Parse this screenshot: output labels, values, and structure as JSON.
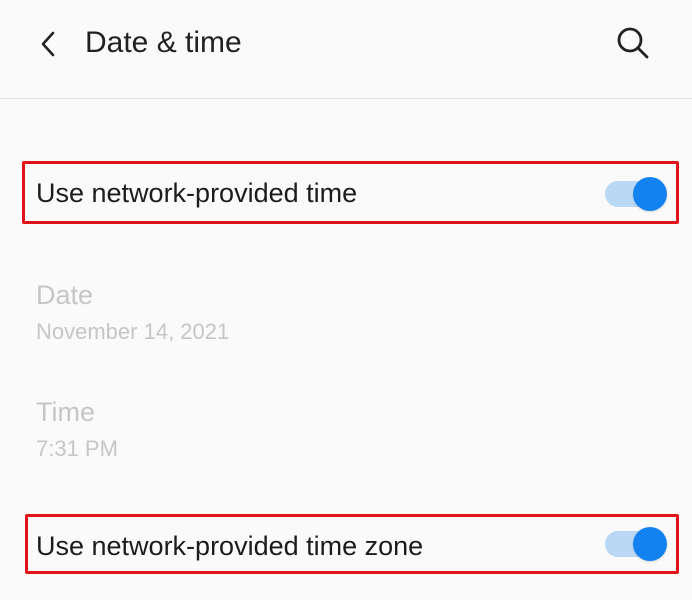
{
  "header": {
    "title": "Date & time",
    "back_icon": "chevron-left-icon",
    "search_icon": "search-icon"
  },
  "settings": {
    "network_time": {
      "label": "Use network-provided time",
      "enabled": true
    },
    "date": {
      "label": "Date",
      "value": "November 14, 2021"
    },
    "time": {
      "label": "Time",
      "value": "7:31 PM"
    },
    "network_time_zone": {
      "label": "Use network-provided time zone",
      "enabled": true
    }
  },
  "colors": {
    "accent": "#1282f0",
    "toggle_track": "#b9d8f6",
    "highlight": "#e0131b",
    "disabled_text": "#c6c6c6",
    "background": "#fafafa"
  }
}
